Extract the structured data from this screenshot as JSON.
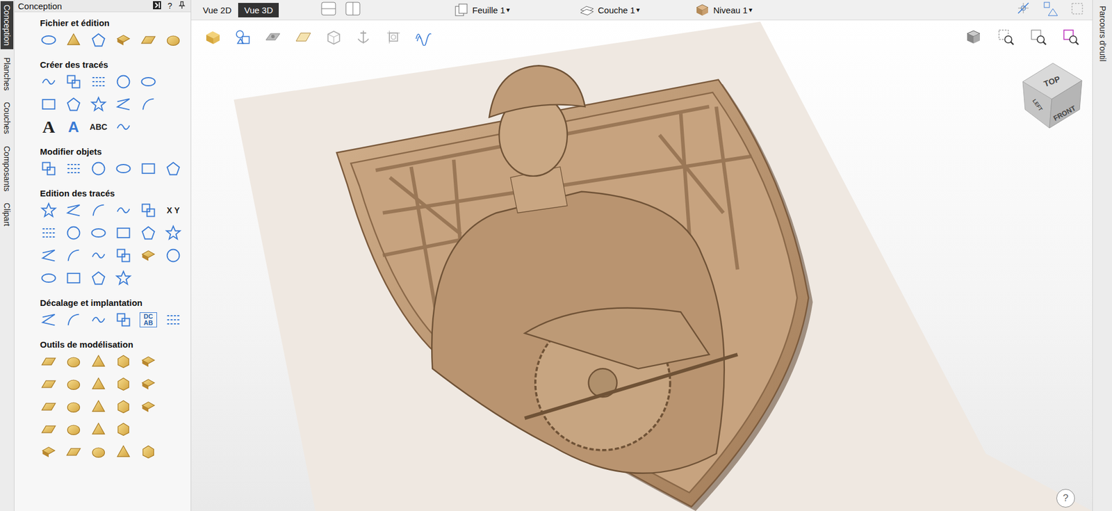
{
  "panel": {
    "title": "Conception",
    "header_icons": [
      "?"
    ]
  },
  "side_tabs": [
    {
      "label": "Conception",
      "selected": true
    },
    {
      "label": "Planches",
      "selected": false
    },
    {
      "label": "Couches",
      "selected": false
    },
    {
      "label": "Composants",
      "selected": false
    },
    {
      "label": "Clipart",
      "selected": false
    }
  ],
  "right_tab": {
    "label": "Parcours d'outil"
  },
  "sections": [
    {
      "title": "Fichier et édition",
      "rows": [
        [
          {
            "kind": "blue"
          },
          {
            "kind": "gold"
          },
          {
            "kind": "blue"
          },
          {
            "kind": "gold"
          },
          {
            "kind": "gold"
          },
          {
            "kind": "gold"
          }
        ]
      ]
    },
    {
      "title": "Créer des tracés",
      "rows": [
        [
          {
            "kind": "blue"
          },
          {
            "kind": "blue"
          },
          {
            "kind": "blue"
          },
          {
            "kind": "blue"
          },
          {
            "kind": "blue"
          }
        ],
        [
          {
            "kind": "blue"
          },
          {
            "kind": "blue"
          },
          {
            "kind": "blue"
          },
          {
            "kind": "blue"
          },
          {
            "kind": "blue"
          }
        ],
        [
          {
            "kind": "text",
            "text": "A"
          },
          {
            "kind": "text",
            "text": "A"
          },
          {
            "kind": "text",
            "text": "ABC"
          },
          {
            "kind": "blue"
          }
        ]
      ]
    },
    {
      "title": "Modifier objets",
      "rows": [
        [
          {
            "kind": "blue"
          },
          {
            "kind": "blue"
          },
          {
            "kind": "blue"
          },
          {
            "kind": "blue"
          },
          {
            "kind": "blue"
          },
          {
            "kind": "blue"
          }
        ]
      ]
    },
    {
      "title": "Edition des tracés",
      "rows": [
        [
          {
            "kind": "blue"
          },
          {
            "kind": "blue"
          },
          {
            "kind": "blue"
          },
          {
            "kind": "blue"
          },
          {
            "kind": "blue"
          },
          {
            "kind": "text",
            "text": "X Y"
          }
        ],
        [
          {
            "kind": "blue"
          },
          {
            "kind": "blue"
          },
          {
            "kind": "blue"
          },
          {
            "kind": "blue"
          },
          {
            "kind": "blue"
          },
          {
            "kind": "blue"
          }
        ],
        [
          {
            "kind": "blue"
          },
          {
            "kind": "blue"
          },
          {
            "kind": "blue"
          },
          {
            "kind": "blue"
          },
          {
            "kind": "gold"
          },
          {
            "kind": "blue"
          }
        ],
        [
          {
            "kind": "blue"
          },
          {
            "kind": "blue"
          },
          {
            "kind": "blue"
          },
          {
            "kind": "blue"
          }
        ]
      ]
    },
    {
      "title": "Décalage et implantation",
      "rows": [
        [
          {
            "kind": "blue"
          },
          {
            "kind": "blue"
          },
          {
            "kind": "blue"
          },
          {
            "kind": "blue"
          },
          {
            "kind": "text",
            "text": "DC AB"
          },
          {
            "kind": "blue"
          }
        ]
      ]
    },
    {
      "title": "Outils de modélisation",
      "rows": [
        [
          {
            "kind": "gold"
          },
          {
            "kind": "gold"
          },
          {
            "kind": "gold"
          },
          {
            "kind": "gold"
          },
          {
            "kind": "gold"
          }
        ],
        [
          {
            "kind": "gold"
          },
          {
            "kind": "gold"
          },
          {
            "kind": "gold"
          },
          {
            "kind": "gold"
          },
          {
            "kind": "gold"
          }
        ],
        [
          {
            "kind": "gold"
          },
          {
            "kind": "gold"
          },
          {
            "kind": "gold"
          },
          {
            "kind": "gold"
          },
          {
            "kind": "gold"
          }
        ],
        [
          {
            "kind": "gold"
          },
          {
            "kind": "gold"
          },
          {
            "kind": "gold"
          },
          {
            "kind": "gold"
          }
        ],
        [
          {
            "kind": "gold"
          },
          {
            "kind": "gold"
          },
          {
            "kind": "gold"
          },
          {
            "kind": "gold"
          },
          {
            "kind": "gold"
          }
        ]
      ]
    }
  ],
  "view_buttons": [
    {
      "label": "Vue 2D",
      "selected": false
    },
    {
      "label": "Vue 3D",
      "selected": true
    }
  ],
  "dropdowns": [
    {
      "label": "Feuille 1",
      "arrow": "▾"
    },
    {
      "label": "Couche 1",
      "arrow": "▾"
    },
    {
      "label": "Niveau 1",
      "arrow": "▾"
    }
  ],
  "view_cube": {
    "top": "TOP",
    "left": "LEFT",
    "front": "FRONT"
  },
  "help": "?"
}
